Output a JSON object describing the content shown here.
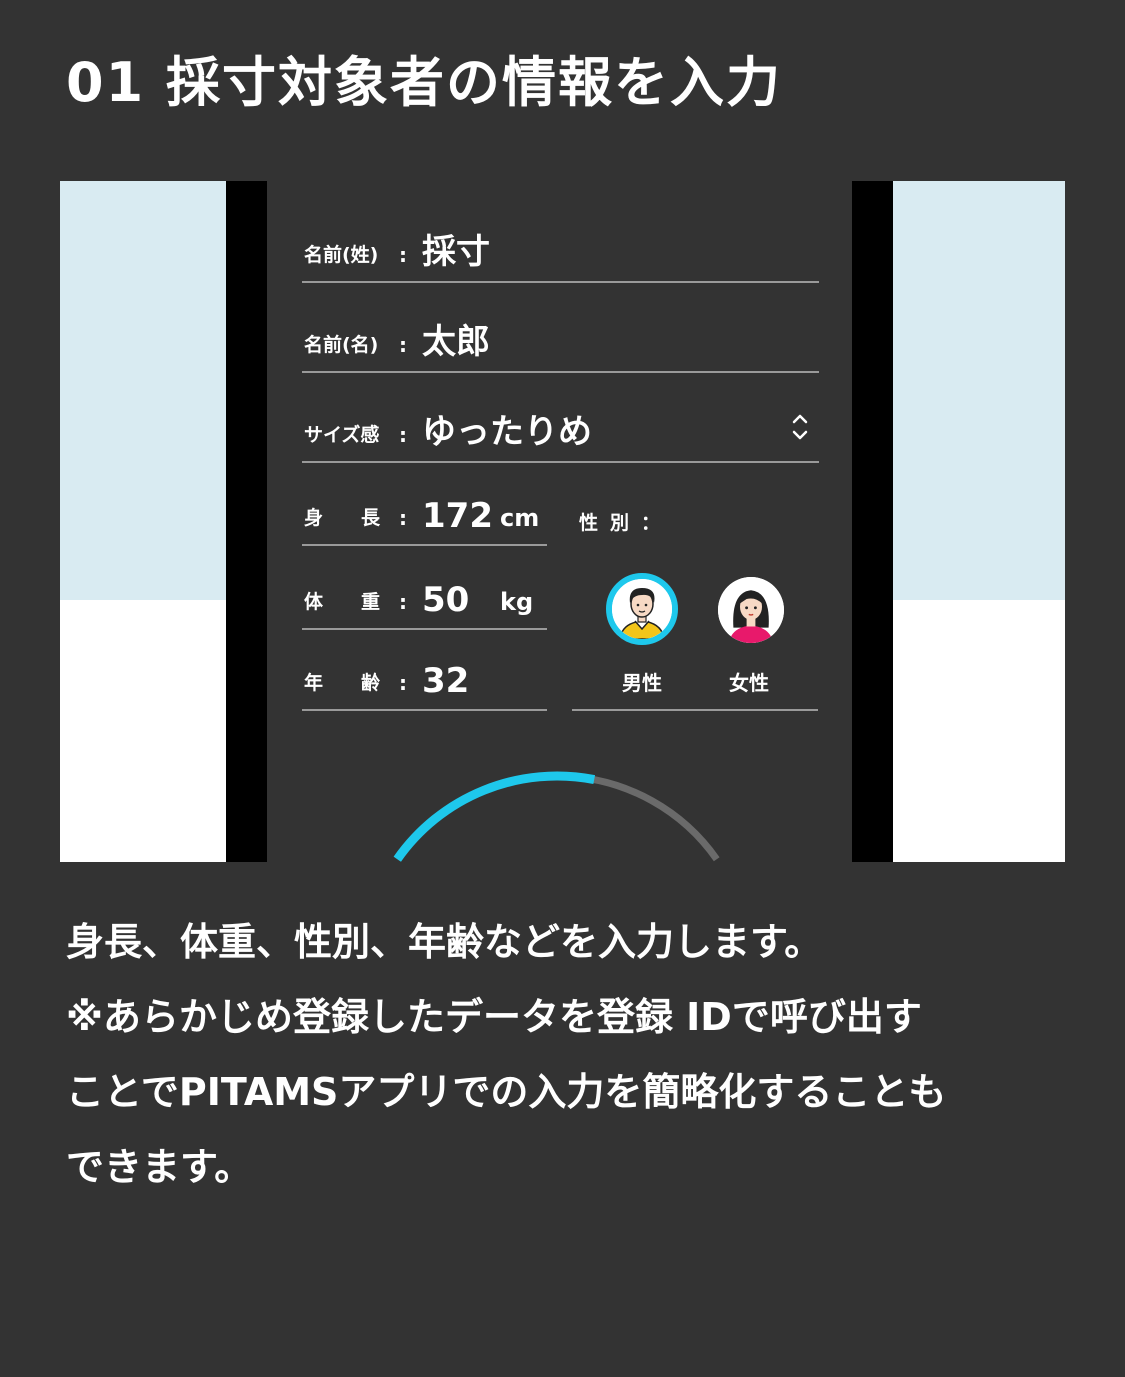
{
  "title": "01 採寸対象者の情報を入力",
  "form": {
    "last_name": {
      "label": "名前(姓)",
      "colon": ":",
      "value": "採寸"
    },
    "first_name": {
      "label": "名前(名)",
      "colon": ":",
      "value": "太郎"
    },
    "size_feel": {
      "label": "サイズ感",
      "colon": ":",
      "value": "ゆったりめ"
    },
    "height": {
      "label": "身　　長",
      "colon": ":",
      "value": "172",
      "unit": "cm"
    },
    "weight": {
      "label": "体　　重",
      "colon": ":",
      "value": "50",
      "unit": "kg"
    },
    "age": {
      "label": "年　　齢",
      "colon": ":",
      "value": "32"
    },
    "gender": {
      "label": "性別：",
      "options": [
        {
          "label": "男性",
          "selected": true,
          "icon": "male-avatar-icon"
        },
        {
          "label": "女性",
          "selected": false,
          "icon": "female-avatar-icon"
        }
      ]
    }
  },
  "progress": {
    "fraction": 0.6,
    "color": "#1ec8ec",
    "track_color": "#6a6a6a"
  },
  "colors": {
    "background": "#333333",
    "accent": "#1ec8ec",
    "preview_light": "#d9ebf2"
  },
  "description": [
    "身長、体重、性別、年齢などを入力します。",
    "※あらかじめ登録したデータを登録 IDで呼び出す",
    "ことでPITAMSアプリでの入力を簡略化することも",
    "できます。"
  ]
}
